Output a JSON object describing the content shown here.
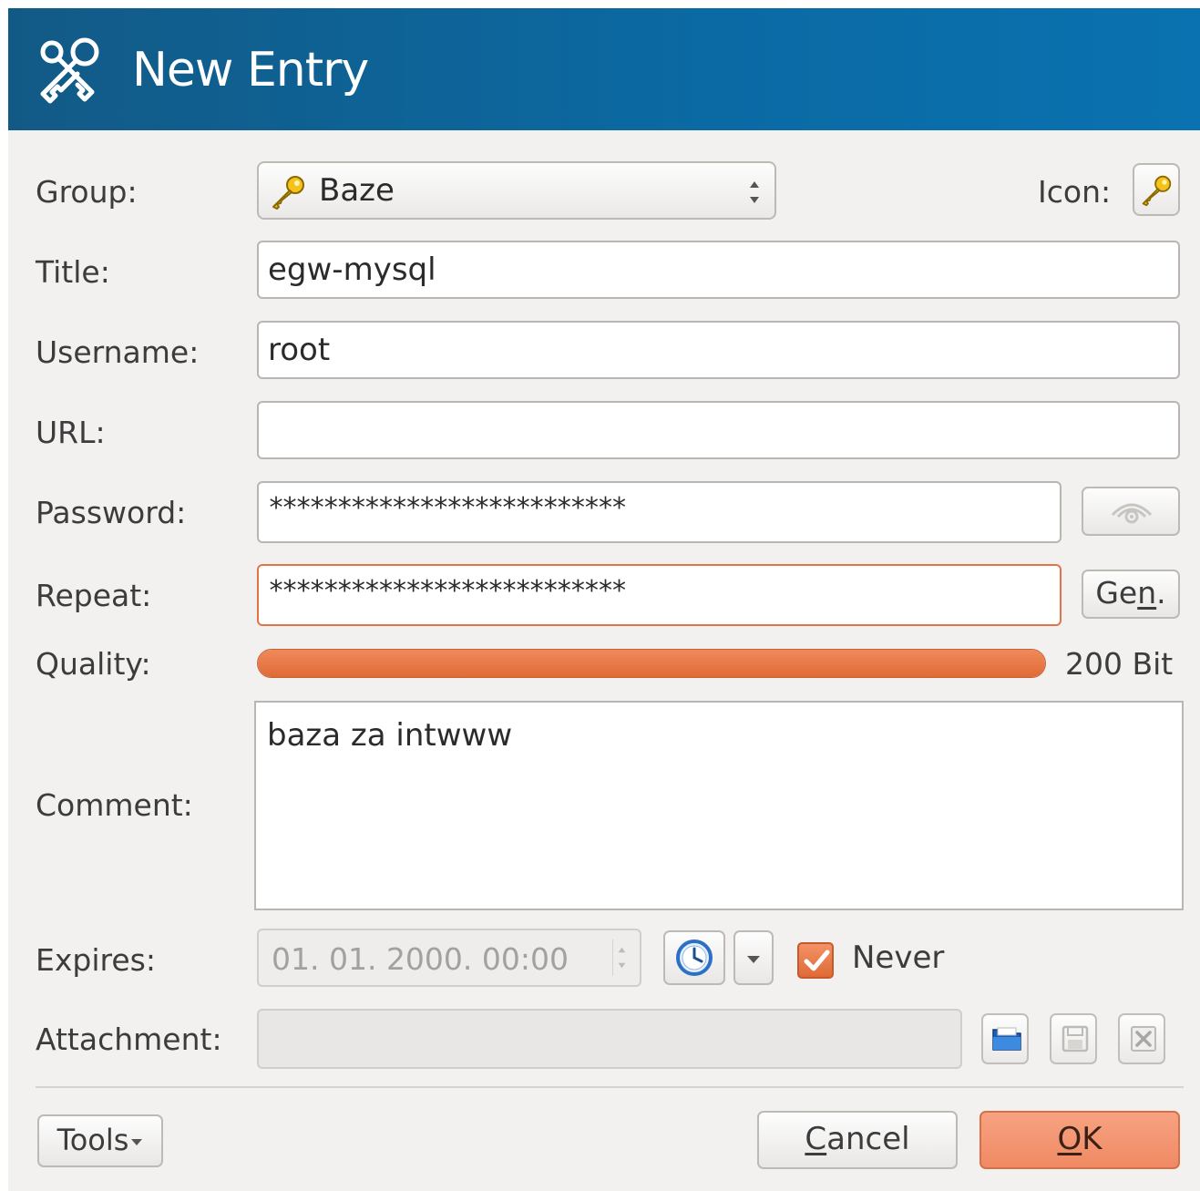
{
  "window": {
    "title": "New Entry",
    "icon": "keys-icon"
  },
  "form": {
    "group_label": "Group:",
    "group_value": "Baze",
    "icon_label": "Icon:",
    "title_label": "Title:",
    "title_value": "egw-mysql",
    "username_label": "Username:",
    "username_value": "root",
    "url_label": "URL:",
    "url_value": "",
    "password_label": "Password:",
    "password_value": "**************************",
    "repeat_label": "Repeat:",
    "repeat_value": "**************************",
    "gen_label_prefix": "Ge",
    "gen_label_underline": "n",
    "gen_label_suffix": ".",
    "quality_label": "Quality:",
    "quality_value": "200 Bit",
    "quality_fraction": 1.0,
    "comment_label": "Comment:",
    "comment_value": "baza za intwww",
    "expires_label": "Expires:",
    "expires_value": "01. 01. 2000. 00:00",
    "never_label": "Never",
    "never_checked": true,
    "attachment_label": "Attachment:",
    "attachment_value": ""
  },
  "buttons": {
    "tools": "Tools",
    "cancel_underline": "C",
    "cancel_rest": "ancel",
    "ok_underline": "O",
    "ok_rest": "K"
  },
  "colors": {
    "header_bg": "#0b6aa4",
    "accent_orange": "#e3744a",
    "ok_button": "#ef8a63"
  }
}
